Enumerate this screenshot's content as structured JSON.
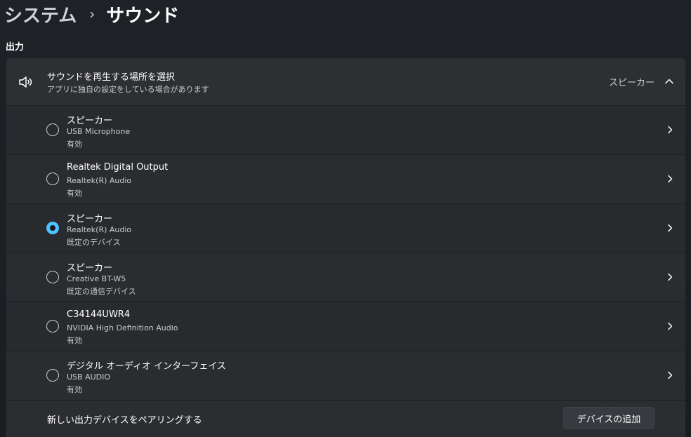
{
  "breadcrumb": {
    "parent": "システム",
    "separator": "›",
    "current": "サウンド"
  },
  "section_title": "出力",
  "output_selector": {
    "title": "サウンドを再生する場所を選択",
    "subtitle": "アプリに独自の設定をしている場合があります",
    "selected_value": "スピーカー",
    "icon": "speaker-icon",
    "expanded": true
  },
  "devices": [
    {
      "name": "スピーカー",
      "driver": "USB Microphone",
      "status": "有効",
      "selected": false
    },
    {
      "name": "Realtek Digital Output",
      "driver": "Realtek(R) Audio",
      "status": "有効",
      "selected": false
    },
    {
      "name": "スピーカー",
      "driver": "Realtek(R) Audio",
      "status": "既定のデバイス",
      "selected": true
    },
    {
      "name": "スピーカー",
      "driver": "Creative BT-W5",
      "status": "既定の通信デバイス",
      "selected": false
    },
    {
      "name": "C34144UWR4",
      "driver": "NVIDIA High Definition Audio",
      "status": "有効",
      "selected": false
    },
    {
      "name": "デジタル オーディオ インターフェイス",
      "driver": "USB AUDIO",
      "status": "有効",
      "selected": false
    }
  ],
  "pair": {
    "label": "新しい出力デバイスをペアリングする",
    "button_label": "デバイスの追加"
  },
  "colors": {
    "accent": "#4cc2ff",
    "card": "#2b2d31",
    "background": "#1c1f24"
  }
}
